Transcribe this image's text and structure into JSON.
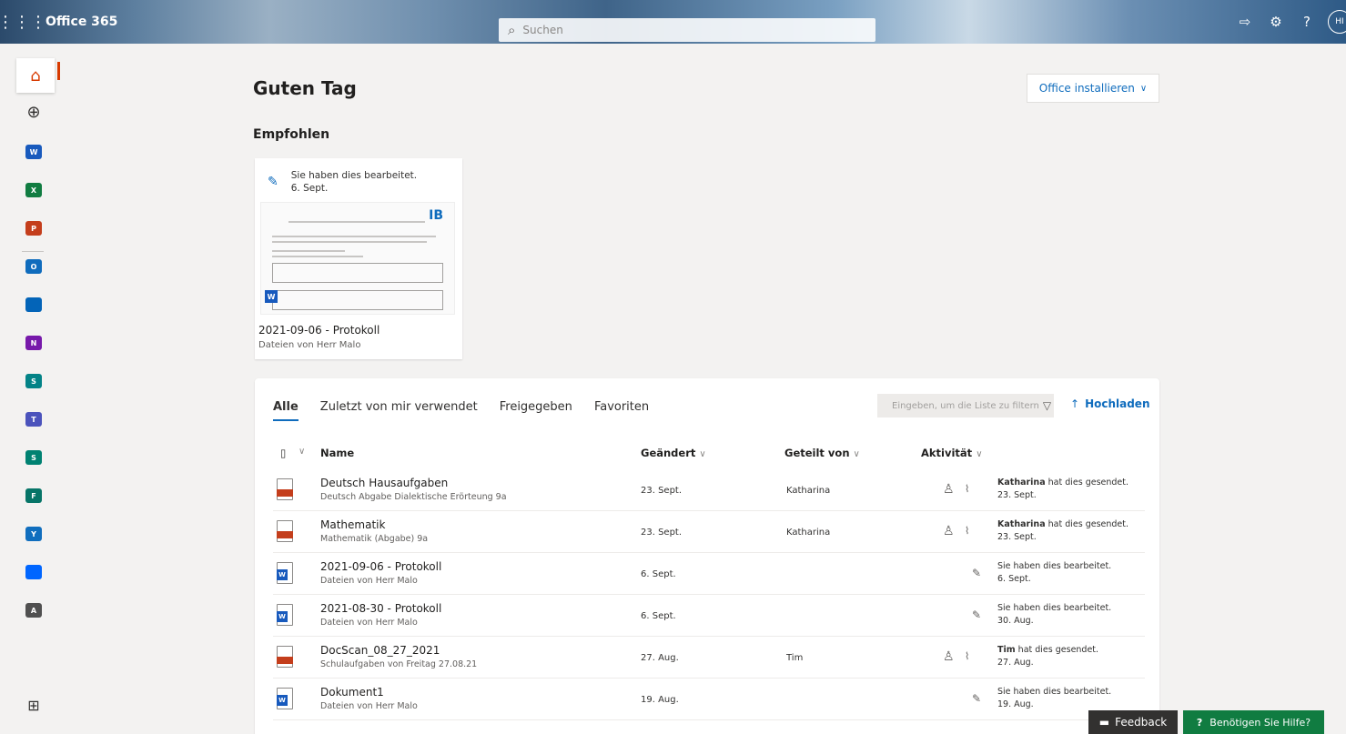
{
  "topbar": {
    "brand": "Office 365",
    "search_placeholder": "Suchen",
    "avatar": "HI"
  },
  "rail": {
    "apps": [
      {
        "name": "word",
        "letter": "W",
        "color": "#185abd"
      },
      {
        "name": "excel",
        "letter": "X",
        "color": "#107c41"
      },
      {
        "name": "powerpoint",
        "letter": "P",
        "color": "#c43e1c"
      },
      {
        "name": "outlook",
        "letter": "O",
        "color": "#0f6cbd"
      },
      {
        "name": "onedrive",
        "letter": "",
        "color": "#0364b8"
      },
      {
        "name": "onenote",
        "letter": "N",
        "color": "#7719aa"
      },
      {
        "name": "sharepoint",
        "letter": "S",
        "color": "#038387"
      },
      {
        "name": "teams",
        "letter": "T",
        "color": "#4b53bc"
      },
      {
        "name": "sway",
        "letter": "S",
        "color": "#008272"
      },
      {
        "name": "forms",
        "letter": "F",
        "color": "#077568"
      },
      {
        "name": "yammer",
        "letter": "Y",
        "color": "#106ebe"
      },
      {
        "name": "power-automate",
        "letter": "",
        "color": "#0066ff"
      },
      {
        "name": "admin",
        "letter": "A",
        "color": "#505050"
      }
    ]
  },
  "main": {
    "greeting": "Guten Tag",
    "install_label": "Office installieren",
    "recommended_title": "Empfohlen",
    "recommended": {
      "activity": "Sie haben dies bearbeitet.",
      "date": "6. Sept.",
      "name": "2021-09-06 - Protokoll",
      "location": "Dateien von Herr Malo"
    }
  },
  "files": {
    "tabs": [
      "Alle",
      "Zuletzt von mir verwendet",
      "Freigegeben",
      "Favoriten"
    ],
    "filter_placeholder": "Eingeben, um die Liste zu filtern",
    "upload_label": "Hochladen",
    "columns": {
      "name": "Name",
      "modified": "Geändert",
      "shared_by": "Geteilt von",
      "activity": "Aktivität"
    },
    "rows": [
      {
        "type": "ppt",
        "name": "Deutsch Hausaufgaben",
        "sub": "Deutsch Abgabe Dialektische Erörteung 9a",
        "date": "23. Sept.",
        "shared": "Katharina",
        "actor": "Katharina",
        "activity": "hat dies gesendet.",
        "adate": "23. Sept.",
        "kind": "sent"
      },
      {
        "type": "ppt",
        "name": "Mathematik",
        "sub": "Mathematik (Abgabe) 9a",
        "date": "23. Sept.",
        "shared": "Katharina",
        "actor": "Katharina",
        "activity": "hat dies gesendet.",
        "adate": "23. Sept.",
        "kind": "sent"
      },
      {
        "type": "word",
        "name": "2021-09-06 - Protokoll",
        "sub": "Dateien von Herr Malo",
        "date": "6. Sept.",
        "shared": "",
        "actor": "",
        "activity": "Sie haben dies bearbeitet.",
        "adate": "6. Sept.",
        "kind": "edit"
      },
      {
        "type": "word",
        "name": "2021-08-30 - Protokoll",
        "sub": "Dateien von Herr Malo",
        "date": "6. Sept.",
        "shared": "",
        "actor": "",
        "activity": "Sie haben dies bearbeitet.",
        "adate": "30. Aug.",
        "kind": "edit"
      },
      {
        "type": "ppt",
        "name": "DocScan_08_27_2021",
        "sub": "Schulaufgaben von Freitag 27.08.21",
        "date": "27. Aug.",
        "shared": "Tim",
        "actor": "Tim",
        "activity": "hat dies gesendet.",
        "adate": "27. Aug.",
        "kind": "sent"
      },
      {
        "type": "word",
        "name": "Dokument1",
        "sub": "Dateien von Herr Malo",
        "date": "19. Aug.",
        "shared": "",
        "actor": "",
        "activity": "Sie haben dies bearbeitet.",
        "adate": "19. Aug.",
        "kind": "edit"
      }
    ]
  },
  "footer": {
    "feedback": "Feedback",
    "help": "Benötigen Sie Hilfe?"
  }
}
